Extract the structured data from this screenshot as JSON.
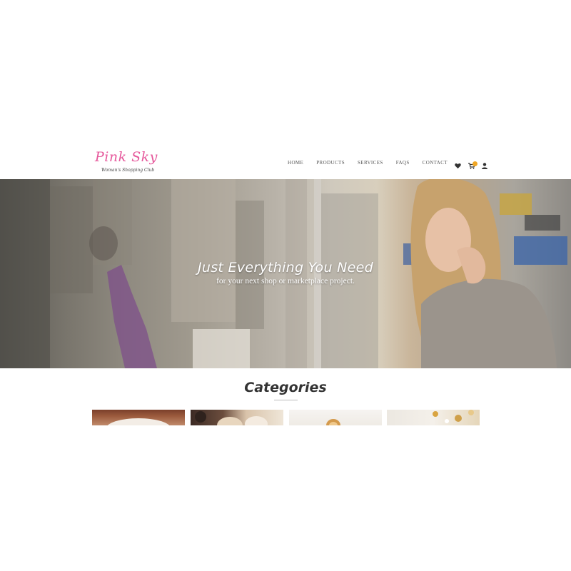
{
  "brand": {
    "name": "Pink Sky",
    "tagline": "Woman's Shopping Club",
    "accent_color": "#e6599c"
  },
  "nav": {
    "items": [
      {
        "label": "HOME"
      },
      {
        "label": "PRODUCTS"
      },
      {
        "label": "SERVICES"
      },
      {
        "label": "FAQS"
      },
      {
        "label": "CONTACT"
      }
    ],
    "icons": [
      "heart-icon",
      "cart-icon",
      "user-icon"
    ],
    "cart_badge_color": "#f0a623"
  },
  "hero": {
    "title": "Just Everything You Need",
    "subtitle": "for your next shop or marketplace project."
  },
  "categories": {
    "title": "Categories"
  }
}
